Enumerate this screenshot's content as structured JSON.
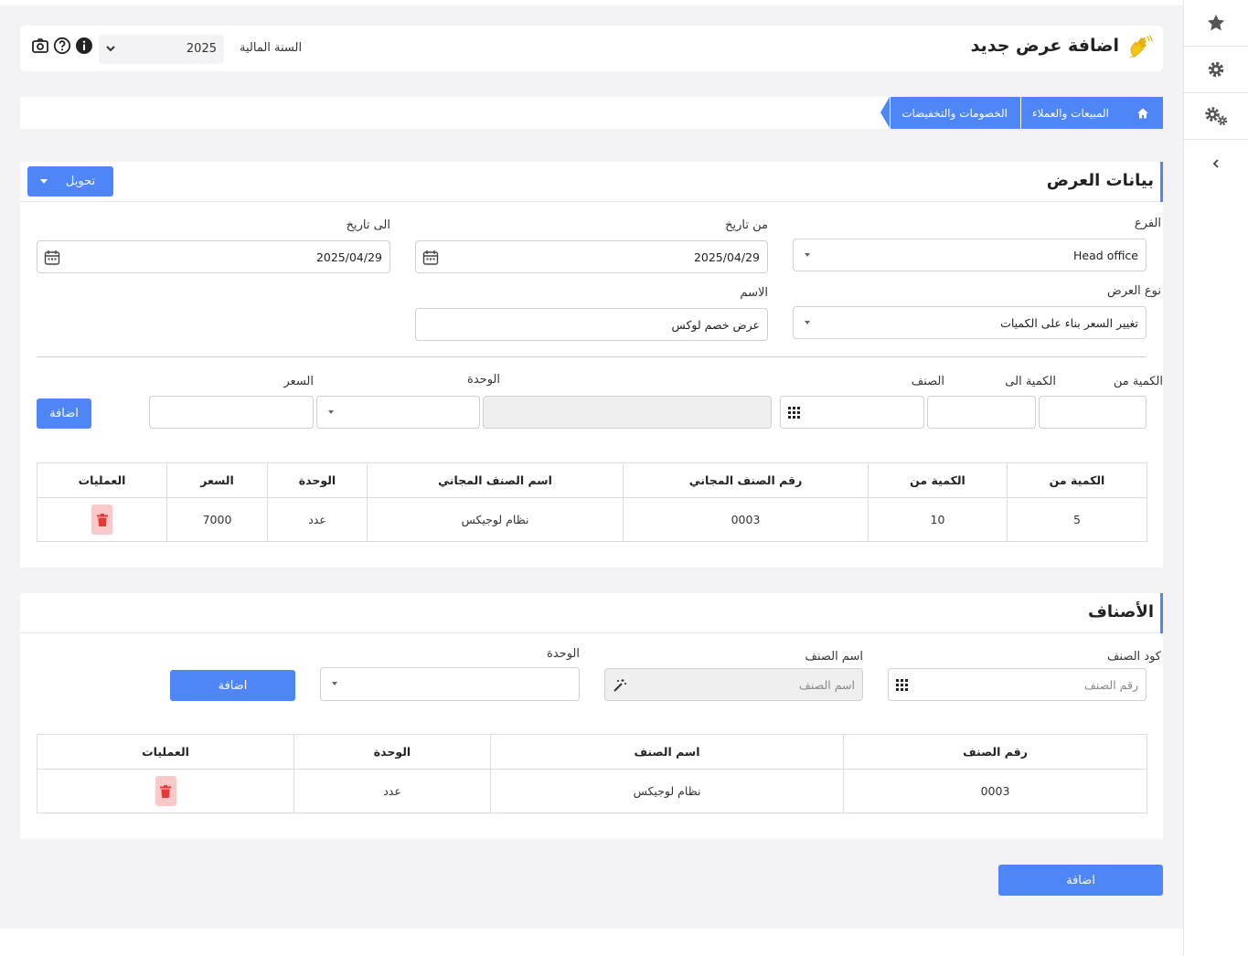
{
  "header": {
    "title": "اضافة عرض جديد",
    "fiscal_year_label": "السنة المالية",
    "fiscal_year_value": "2025"
  },
  "breadcrumb": [
    "المبيعات والعملاء",
    "الخصومات والتخفيضات"
  ],
  "offer_card": {
    "title": "بيانات العرض",
    "convert_button": "تحويل",
    "branch_label": "الفرع",
    "branch_value": "Head office",
    "from_date_label": "من تاريخ",
    "from_date_value": "2025/04/29",
    "to_date_label": "الى تاريخ",
    "to_date_value": "2025/04/29",
    "offer_type_label": "نوع العرض",
    "offer_type_value": "تغيير السعر بناء على الكميات",
    "name_label": "الاسم",
    "name_value": "عرض خصم لوكس",
    "qty_from_label": "الكمية من",
    "qty_to_label": "الكمية الى",
    "item_label": "الصنف",
    "unit_label": "الوحدة",
    "price_label": "السعر",
    "add_button": "اضافة",
    "table": {
      "headers": [
        "الكمية من",
        "الكمية من",
        "رقم الصنف المجاني",
        "اسم الصنف المجاني",
        "الوحدة",
        "السعر",
        "العمليات"
      ],
      "rows": [
        [
          "5",
          "10",
          "0003",
          "نظام لوجيكس",
          "عدد",
          "7000"
        ]
      ]
    }
  },
  "items_card": {
    "title": "الأصناف",
    "code_label": "كود الصنف",
    "code_placeholder": "رقم الصنف",
    "name_label": "اسم الصنف",
    "name_placeholder": "اسم الصنف",
    "unit_label": "الوحدة",
    "add_button": "اضافة",
    "table": {
      "headers": [
        "رقم الصنف",
        "اسم الصنف",
        "الوحدة",
        "العمليات"
      ],
      "rows": [
        [
          "0003",
          "نظام لوجيكس",
          "عدد"
        ]
      ]
    }
  },
  "footer": {
    "submit_button": "اضافة"
  },
  "colors": {
    "accent": "#4f86f7",
    "danger": "#e53935",
    "danger_bg": "#f9c8c8",
    "page_bg": "#f3f3f5"
  },
  "icons": [
    "star-icon",
    "gear-icon",
    "gears-icon",
    "chevron-left-icon",
    "camera-icon",
    "help-icon",
    "info-icon",
    "home-icon",
    "calendar-icon",
    "grid-icon",
    "magic-wand-icon",
    "trash-icon",
    "waving-hand-icon"
  ]
}
